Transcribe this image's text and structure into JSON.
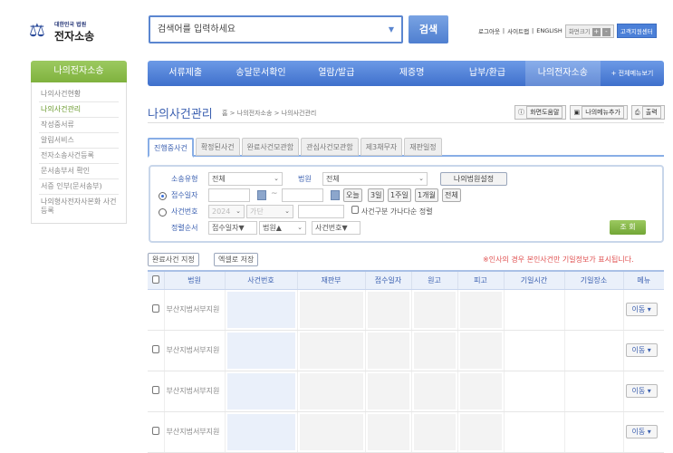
{
  "logo": {
    "small": "대한민국 법원",
    "big": "전자소송"
  },
  "search": {
    "placeholder": "검색어를 입력하세요",
    "button": "검색"
  },
  "toplinks": {
    "logout": "로그아웃",
    "sitemap": "사이트맵",
    "english": "ENGLISH",
    "screen_size": "화면크기",
    "plus": "+",
    "minus": "-",
    "help_center": "고객지원센터"
  },
  "sidebar": {
    "title": "나의전자소송",
    "items": [
      "나의사건현황",
      "나의사건관리",
      "작성중서류",
      "알림서비스",
      "전자소송사건등록",
      "문서송부서 확인",
      "서증 인부(문서송부)",
      "나의형사전자사본화 사건등록"
    ],
    "active": 1
  },
  "nav": {
    "items": [
      "서류제출",
      "송달문서확인",
      "열람/발급",
      "제증명",
      "납부/환급",
      "나의전자소송"
    ],
    "all": "+ 전체메뉴보기"
  },
  "page": {
    "title": "나의사건관리",
    "breadcrumb": "홈 > 나의전자소송 > 나의사건관리",
    "help": "화면도움말",
    "add_menu": "나의메뉴추가",
    "print": "출력"
  },
  "tabs": [
    "진행중사건",
    "확정된사건",
    "완료사건모관함",
    "관심사건모관함",
    "제3채무자",
    "재판일정"
  ],
  "filter": {
    "case_type_label": "소송유형",
    "case_type": "전체",
    "court_label": "법원",
    "court": "전체",
    "my_court": "나의법원설정",
    "date_label": "접수일자",
    "date_sep": "~",
    "quick": [
      "오늘",
      "3일",
      "1주일",
      "1개월",
      "전체"
    ],
    "caseno_label": "사건번호",
    "year": "2024",
    "kind": "가단",
    "sort_check": "사건구분 가나다순 정렬",
    "order_label": "정렬순서",
    "order": [
      "접수일자▼",
      "법원▲",
      "사건번호▼"
    ],
    "query": "조 회"
  },
  "actions": {
    "complete": "완료사건 지정",
    "excel": "엑셀로 저장",
    "note": "※인사의 경우 본인사건만 기일정보가 표시됩니다."
  },
  "table": {
    "headers": [
      "법원",
      "사건번호",
      "재판부",
      "접수일자",
      "원고",
      "피고",
      "기일시간",
      "기일장소",
      "메뉴"
    ],
    "rows": [
      {
        "court": "부산지법서부지원",
        "menu": "이동 ▾"
      },
      {
        "court": "부산지법서부지원",
        "menu": "이동 ▾"
      },
      {
        "court": "부산지법서부지원",
        "menu": "이동 ▾"
      },
      {
        "court": "부산지법서부지원",
        "menu": "이동 ▾"
      }
    ]
  }
}
